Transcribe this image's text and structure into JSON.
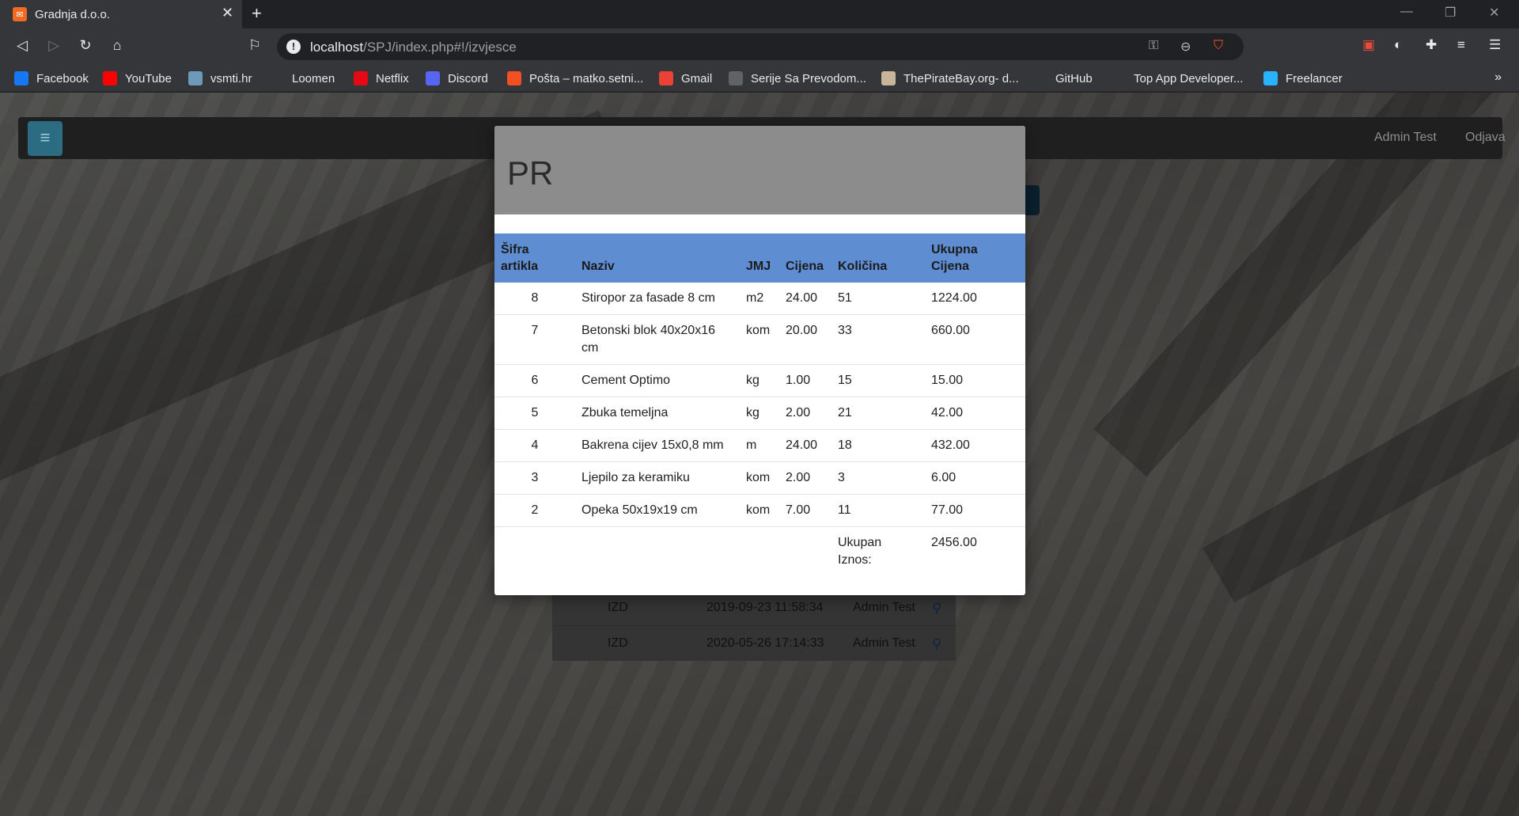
{
  "browser": {
    "tab_title": "Gradnja d.o.o.",
    "url_host": "localhost",
    "url_path": "/SPJ/index.php#!/izvjesce",
    "bookmarks": [
      {
        "label": "Facebook",
        "icon": "facebook-icon",
        "color": "#1877f2"
      },
      {
        "label": "YouTube",
        "icon": "youtube-icon",
        "color": "#ff0000"
      },
      {
        "label": "vsmti.hr",
        "icon": "vsmti-icon",
        "color": "#6d9ab8"
      },
      {
        "label": "Loomen",
        "icon": "loomen-icon",
        "color": "#35363a"
      },
      {
        "label": "Netflix",
        "icon": "netflix-icon",
        "color": "#e50914"
      },
      {
        "label": "Discord",
        "icon": "discord-icon",
        "color": "#5865f2"
      },
      {
        "label": "Pošta – matko.setni...",
        "icon": "microsoft-icon",
        "color": "#f25022"
      },
      {
        "label": "Gmail",
        "icon": "gmail-icon",
        "color": "#ea4335"
      },
      {
        "label": "Serije Sa Prevodom...",
        "icon": "globe-icon",
        "color": "#5f6368"
      },
      {
        "label": "ThePirateBay.org- d...",
        "icon": "piratebay-icon",
        "color": "#c8b59a"
      },
      {
        "label": "GitHub",
        "icon": "github-icon",
        "color": "#35363a"
      },
      {
        "label": "Top App Developer...",
        "icon": "topapp-icon",
        "color": "#35363a"
      },
      {
        "label": "Freelancer",
        "icon": "freelancer-icon",
        "color": "#29b2fe"
      }
    ]
  },
  "app": {
    "user": "Admin Test",
    "logout": "Odjava",
    "background_rows": [
      {
        "type": "IZD",
        "date": "2019-09-23 11:58:34",
        "user": "Admin Test"
      },
      {
        "type": "IZD",
        "date": "2020-05-26 17:14:33",
        "user": "Admin Test"
      }
    ]
  },
  "modal": {
    "title": "PR",
    "columns": {
      "code": "Šifra artikla",
      "name": "Naziv",
      "unit": "JMJ",
      "price": "Cijena",
      "qty": "Količina",
      "total": "Ukupna Cijena"
    },
    "rows": [
      {
        "code": "8",
        "name": "Stiropor za fasade 8 cm",
        "unit": "m2",
        "price": "24.00",
        "qty": "51",
        "total": "1224.00"
      },
      {
        "code": "7",
        "name": "Betonski blok 40x20x16 cm",
        "unit": "kom",
        "price": "20.00",
        "qty": "33",
        "total": "660.00"
      },
      {
        "code": "6",
        "name": "Cement Optimo",
        "unit": "kg",
        "price": "1.00",
        "qty": "15",
        "total": "15.00"
      },
      {
        "code": "5",
        "name": "Zbuka temeljna",
        "unit": "kg",
        "price": "2.00",
        "qty": "21",
        "total": "42.00"
      },
      {
        "code": "4",
        "name": "Bakrena cijev 15x0,8 mm",
        "unit": "m",
        "price": "24.00",
        "qty": "18",
        "total": "432.00"
      },
      {
        "code": "3",
        "name": "Ljepilo za keramiku",
        "unit": "kom",
        "price": "2.00",
        "qty": "3",
        "total": "6.00"
      },
      {
        "code": "2",
        "name": "Opeka 50x19x19 cm",
        "unit": "kom",
        "price": "7.00",
        "qty": "11",
        "total": "77.00"
      }
    ],
    "total_label": "Ukupan Iznos:",
    "total_value": "2456.00"
  }
}
